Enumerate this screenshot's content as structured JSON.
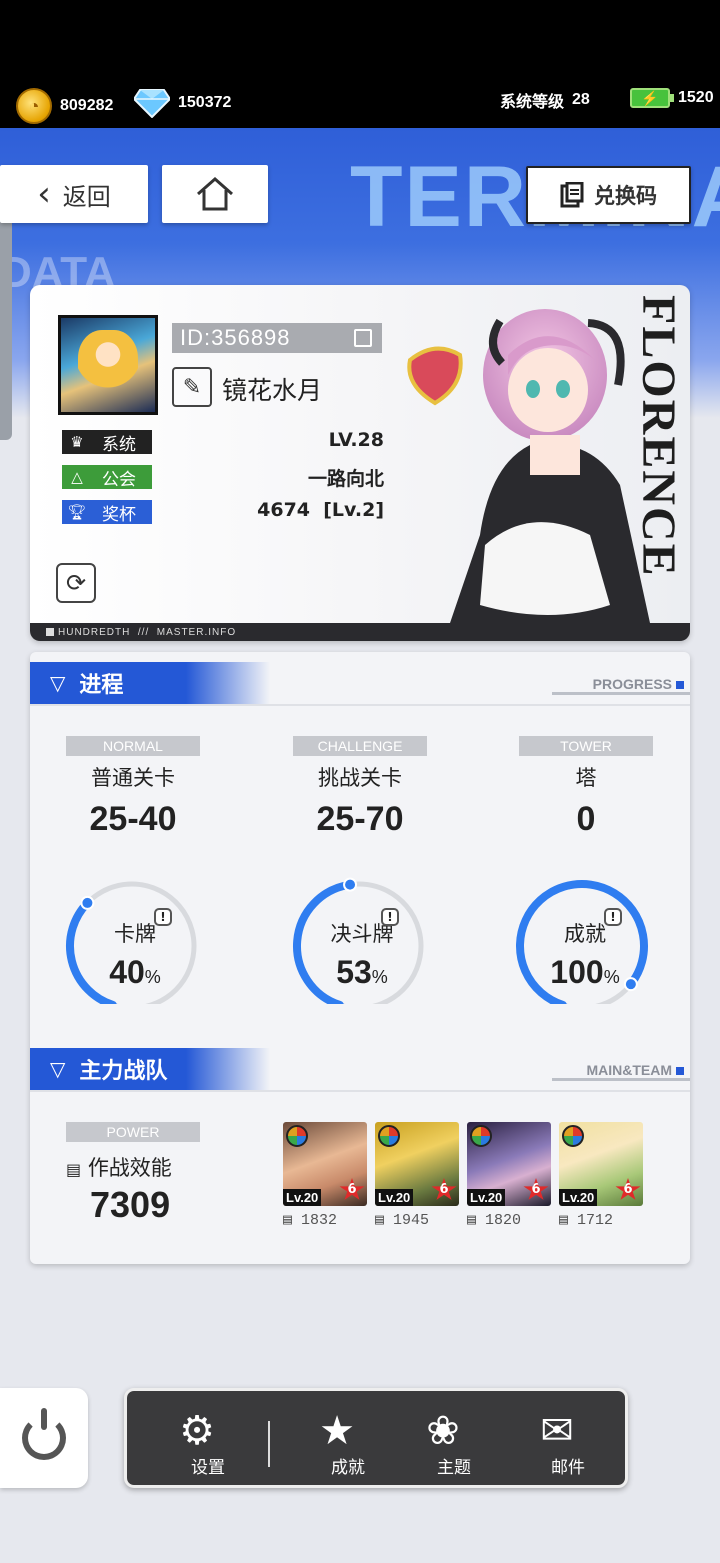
{
  "topbar": {
    "gold": "809282",
    "gems": "150372",
    "system_level_label": "系统等级",
    "system_level": "28",
    "energy": "1520"
  },
  "header": {
    "bg_text": "TERMINAL",
    "bg_text2": "DATA",
    "back_label": "返回",
    "redeem_label": "兑换码"
  },
  "profile": {
    "id": "ID:356898",
    "nickname": "镜花水月",
    "tags": [
      {
        "label": "系统",
        "value": "LV.28"
      },
      {
        "label": "公会",
        "value": "一路向北"
      },
      {
        "label": "奖杯",
        "value": "4674  [Lv.2]"
      }
    ],
    "character_name": "FLORENCE",
    "footer": "HUNDREDTH  ///  MASTER.INFO"
  },
  "progress": {
    "title": "进程",
    "title_en": "PROGRESS",
    "columns": [
      {
        "en": "NORMAL",
        "cn": "普通关卡",
        "value": "25-40"
      },
      {
        "en": "CHALLENGE",
        "cn": "挑战关卡",
        "value": "25-70"
      },
      {
        "en": "TOWER",
        "cn": "塔",
        "value": "0"
      }
    ],
    "gauges": [
      {
        "name": "卡牌",
        "pct": "40",
        "fraction": 0.4
      },
      {
        "name": "决斗牌",
        "pct": "53",
        "fraction": 0.53
      },
      {
        "name": "成就",
        "pct": "100",
        "fraction": 1.0
      }
    ],
    "pct_symbol": "%",
    "accent": "#2f7df0"
  },
  "team": {
    "title": "主力战队",
    "title_en": "MAIN&TEAM",
    "power_en": "POWER",
    "power_cn": "作战效能",
    "power_value": "7309",
    "cards": [
      {
        "lv": "Lv.20",
        "stars": "6",
        "power": "1832"
      },
      {
        "lv": "Lv.20",
        "stars": "6",
        "power": "1945"
      },
      {
        "lv": "Lv.20",
        "stars": "6",
        "power": "1820"
      },
      {
        "lv": "Lv.20",
        "stars": "6",
        "power": "1712"
      }
    ]
  },
  "nav": {
    "settings": "设置",
    "achievements": "成就",
    "theme": "主题",
    "mail": "邮件"
  }
}
